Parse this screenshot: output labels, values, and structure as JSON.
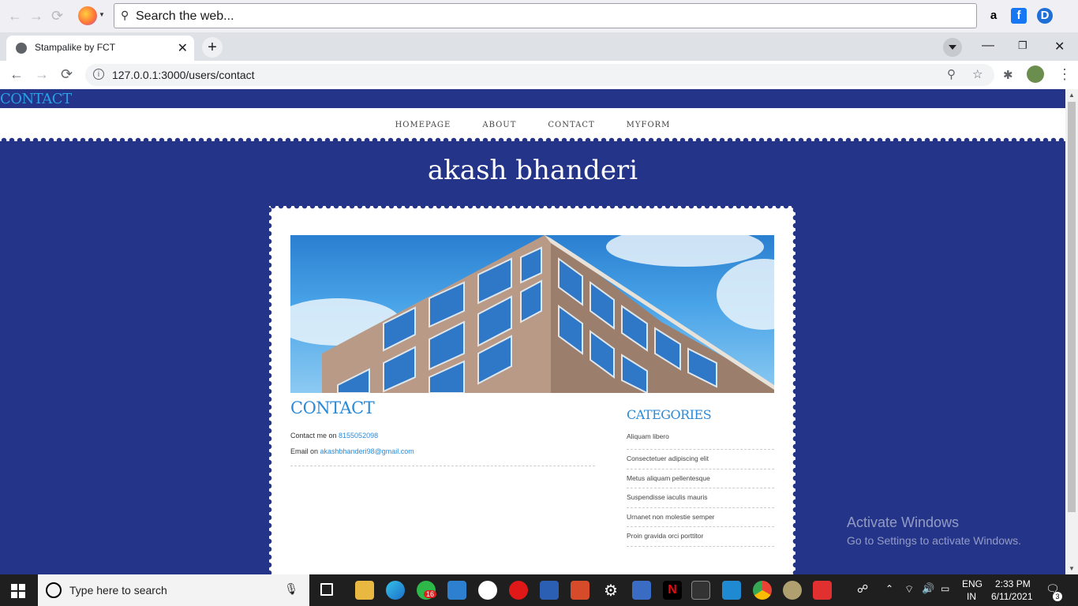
{
  "firefox": {
    "search_placeholder": "Search the web..."
  },
  "tab": {
    "title": "Stampalike by FCT",
    "close": "✕",
    "new": "+"
  },
  "address": {
    "url": "127.0.0.1:3000/users/contact"
  },
  "page": {
    "top_heading": "CONTACT",
    "menu": [
      "HOMEPAGE",
      "ABOUT",
      "CONTACT",
      "MYFORM"
    ],
    "site_title": "akash bhanderi",
    "main": {
      "heading": "CONTACT",
      "phone_prefix": "Contact me on ",
      "phone": "8155052098",
      "email_prefix": "Email on ",
      "email": "akashbhanderi98@gmail.com"
    },
    "sidebar": {
      "heading": "CATEGORIES",
      "items": [
        "Aliquam libero",
        "Consectetuer adipiscing elit",
        "Metus aliquam pellentesque",
        "Suspendisse iaculis mauris",
        "Urnanet non molestie semper",
        "Proin gravida orci porttitor"
      ]
    }
  },
  "watermark": {
    "line1": "Activate Windows",
    "line2": "Go to Settings to activate Windows."
  },
  "taskbar": {
    "search_placeholder": "Type here to search",
    "whatsapp_badge": "16",
    "lang": "ENG",
    "region": "IN",
    "time": "2:33 PM",
    "date": "6/11/2021",
    "notification_count": "3"
  },
  "colors": {
    "page_bg": "#243488",
    "accent": "#2a8ad8",
    "taskbar": "#1f1f1f"
  }
}
